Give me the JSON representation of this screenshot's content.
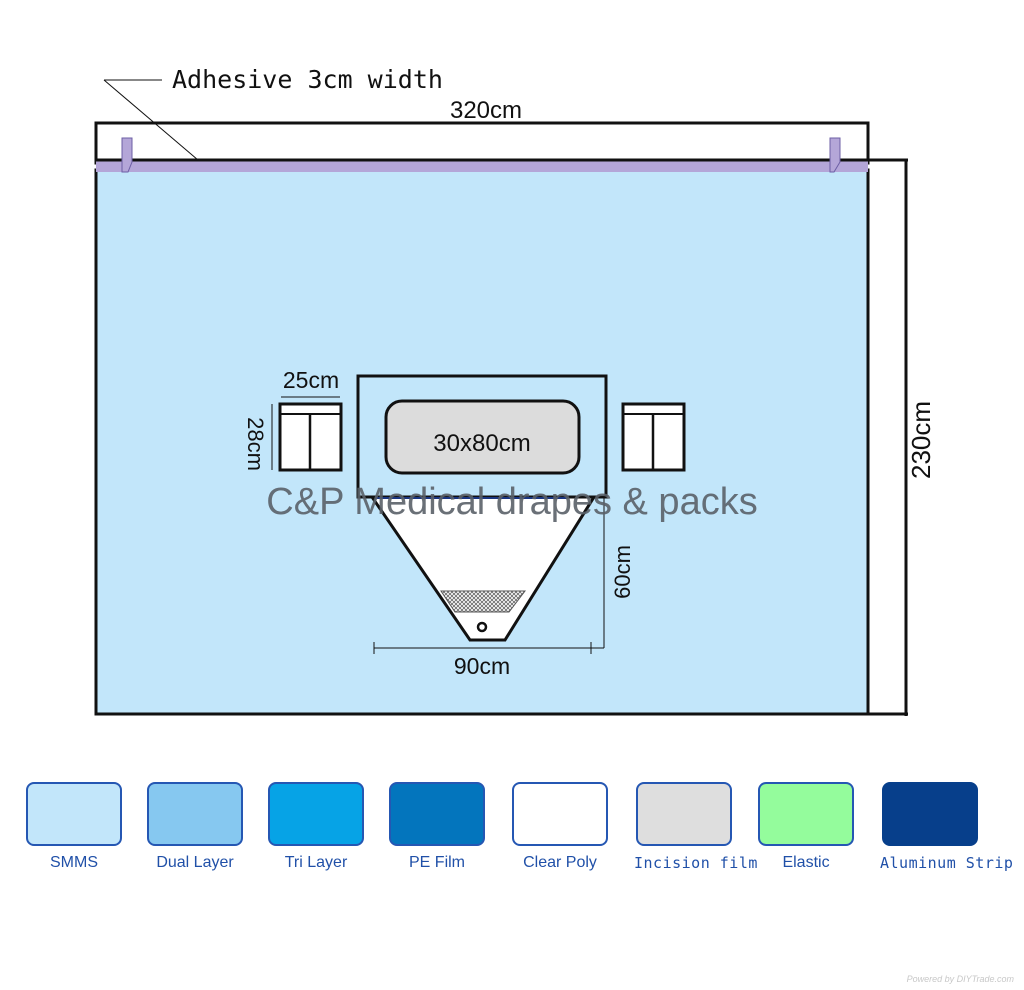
{
  "diagram": {
    "adhesive_label": "Adhesive 3cm width",
    "width_label": "320cm",
    "height_label": "230cm",
    "pocket_width_label": "25cm",
    "pocket_height_label": "28cm",
    "incision_label": "30x80cm",
    "pouch_height_label": "60cm",
    "pouch_width_label": "90cm",
    "watermark": "C&P Medical drapes & packs"
  },
  "legend": {
    "items": [
      {
        "label": "SMMS",
        "color": "#c2e6fa"
      },
      {
        "label": "Dual Layer",
        "color": "#86c8f0"
      },
      {
        "label": "Tri Layer",
        "color": "#06a3e6"
      },
      {
        "label": "PE Film",
        "color": "#0375bd"
      },
      {
        "label": "Clear Poly",
        "color": "#ffffff"
      },
      {
        "label": "Incision film",
        "color": "#dedede"
      },
      {
        "label": "Elastic",
        "color": "#94fc9c"
      },
      {
        "label": "Aluminum Strip",
        "color": "#073f8b"
      }
    ]
  },
  "colors": {
    "drape": "#c2e6fa",
    "adhesive": "#b4a6d8",
    "incision": "#dcdcdc",
    "outline": "#111111",
    "watermark": "#5a6068"
  },
  "footer": {
    "credit": "Powered by DIYTrade.com"
  }
}
